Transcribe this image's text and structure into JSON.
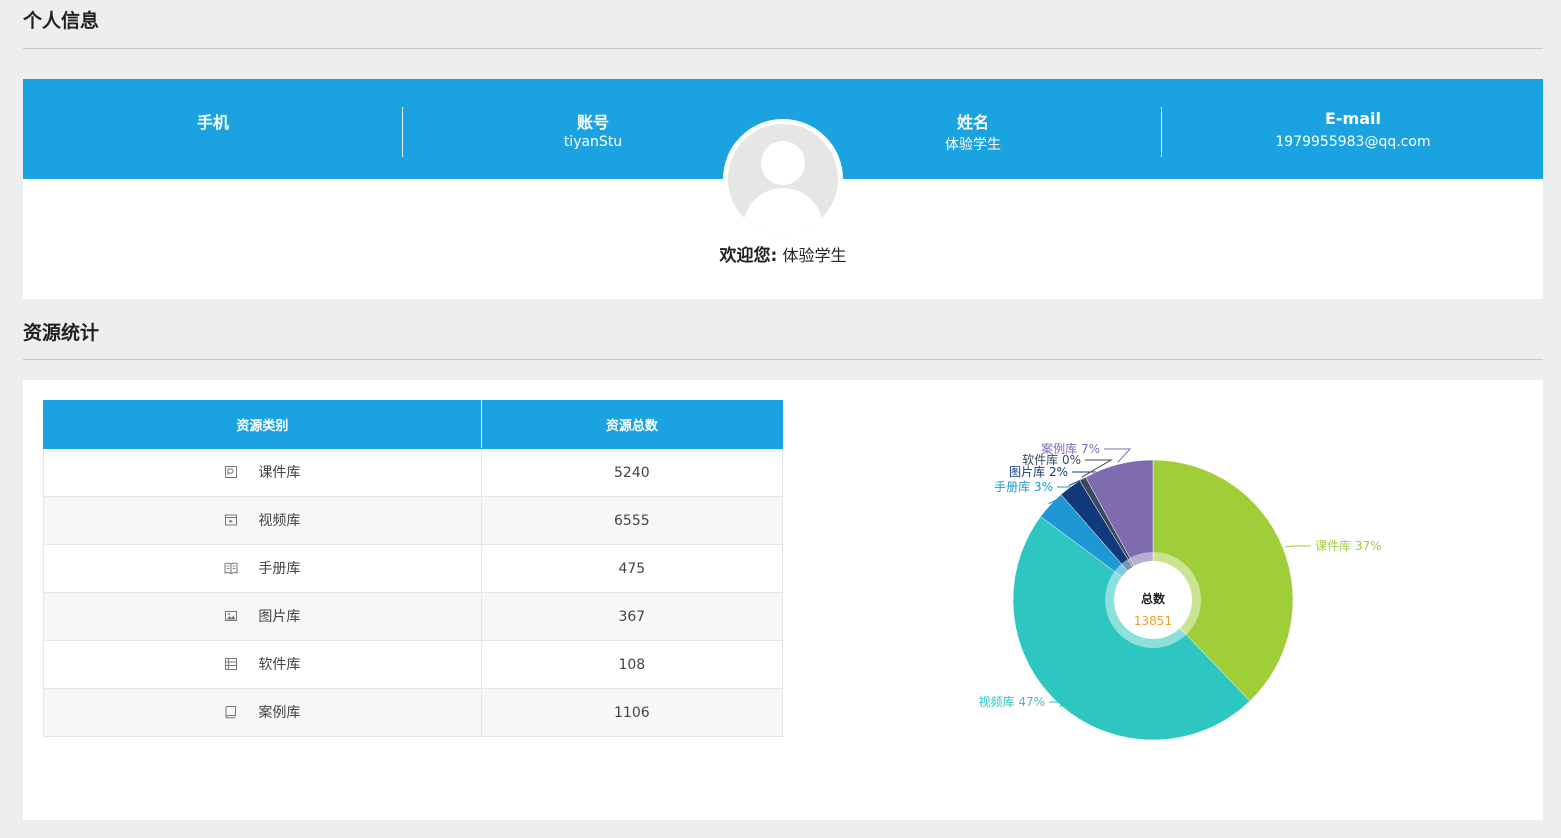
{
  "sections": {
    "profile_title": "个人信息",
    "stats_title": "资源统计"
  },
  "profile": {
    "phone_label": "手机",
    "phone_value": "",
    "account_label": "账号",
    "account_value": "tiyanStu",
    "name_label": "姓名",
    "name_value": "体验学生",
    "email_label": "E-mail",
    "email_value": "1979955983@qq.com",
    "welcome_label": "欢迎您:",
    "welcome_name": "体验学生"
  },
  "table": {
    "headers": [
      "资源类别",
      "资源总数"
    ],
    "rows": [
      {
        "icon": "courseware-icon",
        "name": "课件库",
        "count": "5240"
      },
      {
        "icon": "video-icon",
        "name": "视频库",
        "count": "6555"
      },
      {
        "icon": "book-icon",
        "name": "手册库",
        "count": "475"
      },
      {
        "icon": "image-icon",
        "name": "图片库",
        "count": "367"
      },
      {
        "icon": "software-icon",
        "name": "软件库",
        "count": "108"
      },
      {
        "icon": "case-icon",
        "name": "案例库",
        "count": "1106"
      }
    ]
  },
  "chart_data": {
    "type": "pie",
    "center_label": "总数",
    "center_value": "13851",
    "slices": [
      {
        "name": "课件库",
        "value": 5240,
        "label": "课件库 37%",
        "color": "#a0ce39"
      },
      {
        "name": "视频库",
        "value": 6555,
        "label": "视频库 47%",
        "color": "#2ec6c0"
      },
      {
        "name": "手册库",
        "value": 475,
        "label": "手册库 3%",
        "color": "#1e98d4"
      },
      {
        "name": "图片库",
        "value": 367,
        "label": "图片库 2%",
        "color": "#123a7a"
      },
      {
        "name": "软件库",
        "value": 108,
        "label": "软件库 0%",
        "color": "#3a4a5a"
      },
      {
        "name": "案例库",
        "value": 1106,
        "label": "案例库 7%",
        "color": "#7e6bb0"
      }
    ],
    "center_value_color": "#f0a030"
  }
}
